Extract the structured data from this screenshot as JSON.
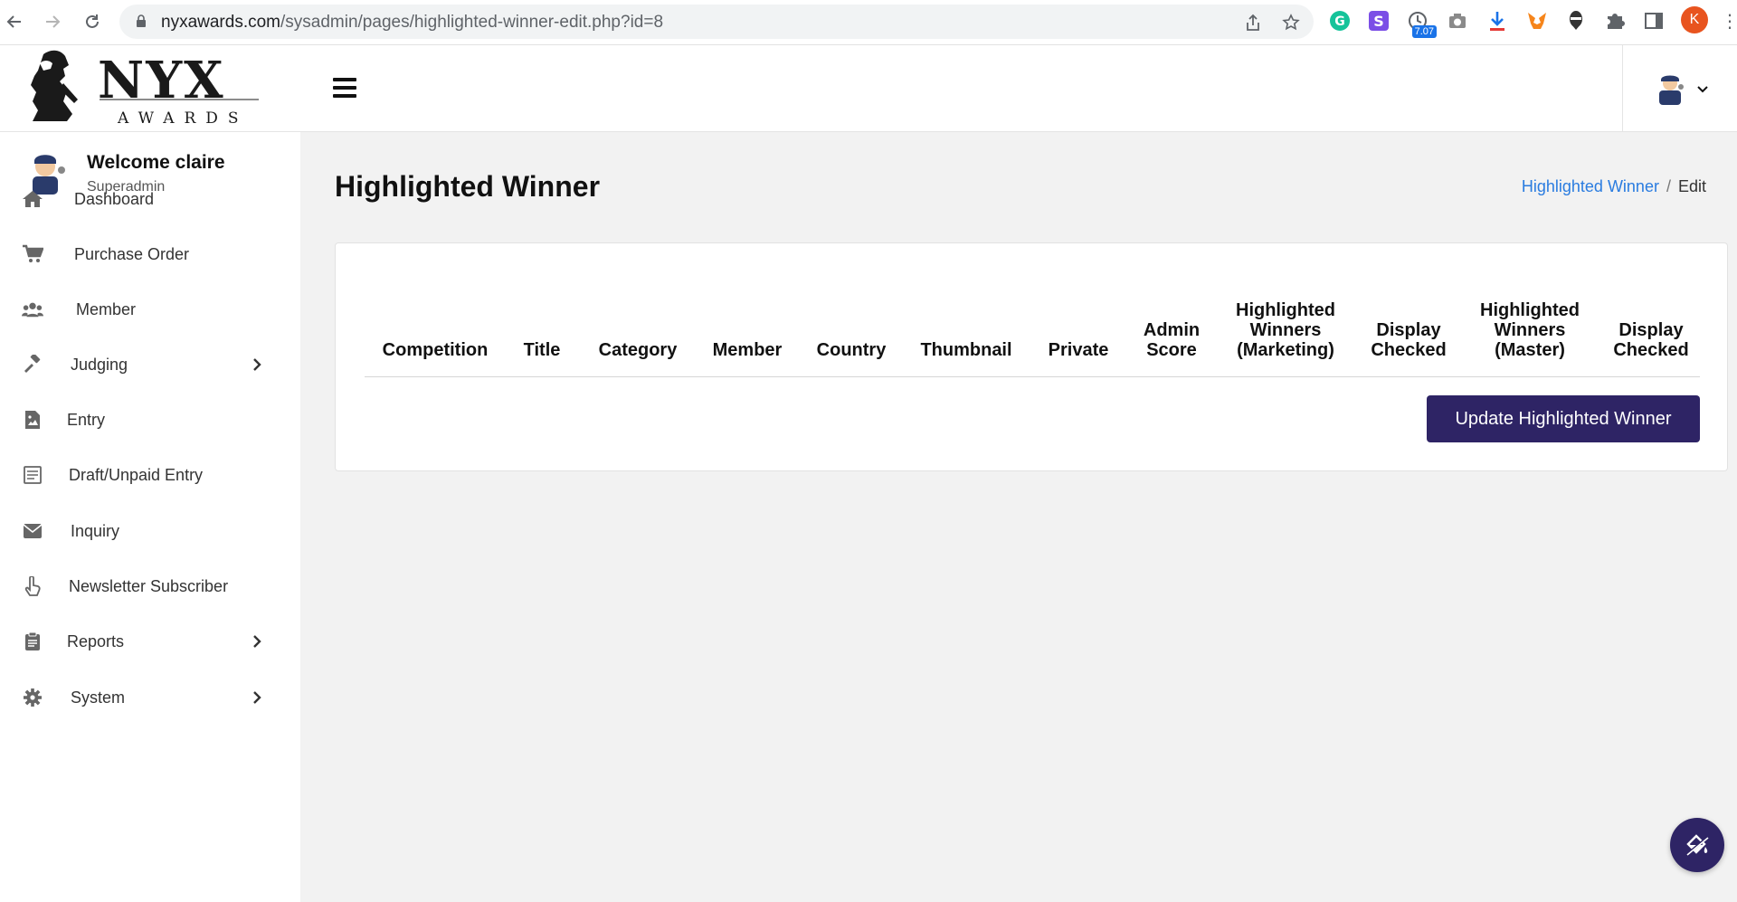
{
  "browser": {
    "url_domain": "nyxawards.com",
    "url_path": "/sysadmin/pages/highlighted-winner-edit.php?id=8",
    "extension_badge": "7.07",
    "profile_initial": "K"
  },
  "header": {
    "logo_main": "NYX",
    "logo_sub": "AWARDS"
  },
  "sidebar": {
    "welcome_name": "Welcome claire",
    "welcome_role": "Superadmin",
    "items": [
      {
        "label": "Dashboard",
        "icon": "home-icon"
      },
      {
        "label": "Purchase Order",
        "icon": "cart-icon"
      },
      {
        "label": "Member",
        "icon": "users-icon"
      },
      {
        "label": "Judging",
        "icon": "gavel-icon",
        "has_submenu": true
      },
      {
        "label": "Entry",
        "icon": "file-image-icon"
      },
      {
        "label": "Draft/Unpaid Entry",
        "icon": "file-list-icon"
      },
      {
        "label": "Inquiry",
        "icon": "envelope-icon"
      },
      {
        "label": "Newsletter Subscriber",
        "icon": "hand-pointer-icon"
      },
      {
        "label": "Reports",
        "icon": "clipboard-icon",
        "has_submenu": true
      },
      {
        "label": "System",
        "icon": "gear-icon",
        "has_submenu": true
      }
    ]
  },
  "main": {
    "title": "Highlighted Winner",
    "breadcrumb": {
      "link": "Highlighted Winner",
      "separator": "/",
      "current": "Edit"
    },
    "table": {
      "columns": [
        "Competition",
        "Title",
        "Category",
        "Member",
        "Country",
        "Thumbnail",
        "Private",
        "Admin Score",
        "Highlighted Winners (Marketing)",
        "Display Checked",
        "Highlighted Winners (Master)",
        "Display Checked"
      ],
      "rows": []
    },
    "update_button": "Update Highlighted Winner"
  },
  "colors": {
    "primary": "#2e2465",
    "link": "#2a7ce0",
    "background": "#f2f2f2"
  }
}
